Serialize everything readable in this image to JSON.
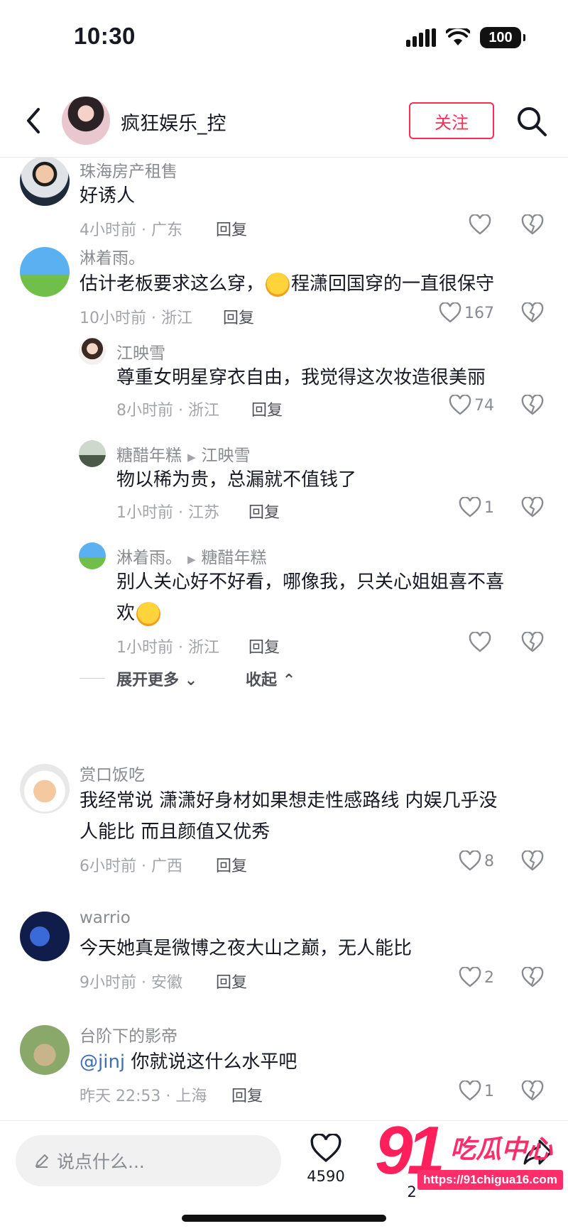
{
  "status_bar": {
    "time": "10:30",
    "battery": "100"
  },
  "header": {
    "account_name": "疯狂娱乐_控",
    "follow_label": "关注"
  },
  "comments": [
    {
      "user": "珠海房产租售",
      "text": "好诱人",
      "time_location": "4小时前 · 广东",
      "reply_label": "回复",
      "likes": ""
    },
    {
      "user": "淋着雨。",
      "text_before": "估计老板要求这么穿，",
      "emoji": "crying-laughing-emoji",
      "text_after": "程潇回国穿的一直很保守",
      "time_location": "10小时前 · 浙江",
      "reply_label": "回复",
      "likes": "167",
      "replies": [
        {
          "user": "江映雪",
          "reply_to": "",
          "text": "尊重女明星穿衣自由，我觉得这次妆造很美丽",
          "time_location": "8小时前 · 浙江",
          "reply_label": "回复",
          "likes": "74"
        },
        {
          "user": "糖醋年糕",
          "reply_to": "江映雪",
          "text": "物以稀为贵，总漏就不值钱了",
          "time_location": "1小时前 · 江苏",
          "reply_label": "回复",
          "likes": "1"
        },
        {
          "user": "淋着雨。",
          "reply_to": "糖醋年糕",
          "text_line1": "别人关心好不好看，哪像我，只关心姐姐喜不喜",
          "text_line2": "欢",
          "emoji": "thinking-face-emoji",
          "time_location": "1小时前 · 浙江",
          "reply_label": "回复",
          "likes": ""
        }
      ],
      "expand_label": "展开更多",
      "collapse_label": "收起"
    },
    {
      "user": "赏口饭吃",
      "text_line1": "我经常说  潇潇好身材如果想走性感路线 内娱几乎没",
      "text_line2": "人能比 而且颜值又优秀",
      "time_location": "6小时前 · 广西",
      "reply_label": "回复",
      "likes": "8"
    },
    {
      "user": "warrio",
      "text": "今天她真是微博之夜大山之巅，无人能比",
      "time_location": "9小时前 · 安徽",
      "reply_label": "回复",
      "likes": "2"
    },
    {
      "user": "台阶下的影帝",
      "mention": "@jinj",
      "text": " 你就说这什么水平吧",
      "time_location": "昨天 22:53 · 上海",
      "reply_label": "回复",
      "likes": "1"
    }
  ],
  "bottom_bar": {
    "input_placeholder": "说点什么...",
    "like_count": "4590",
    "share_count_partial": "2"
  },
  "watermark": {
    "logo_text": "91",
    "brand_text": "吃瓜中心",
    "url": "https://91chigua16.com"
  },
  "colors": {
    "accent": "#fe2c55",
    "link": "#3f6eb5",
    "text": "#161823",
    "meta": "#a3a4a9"
  }
}
